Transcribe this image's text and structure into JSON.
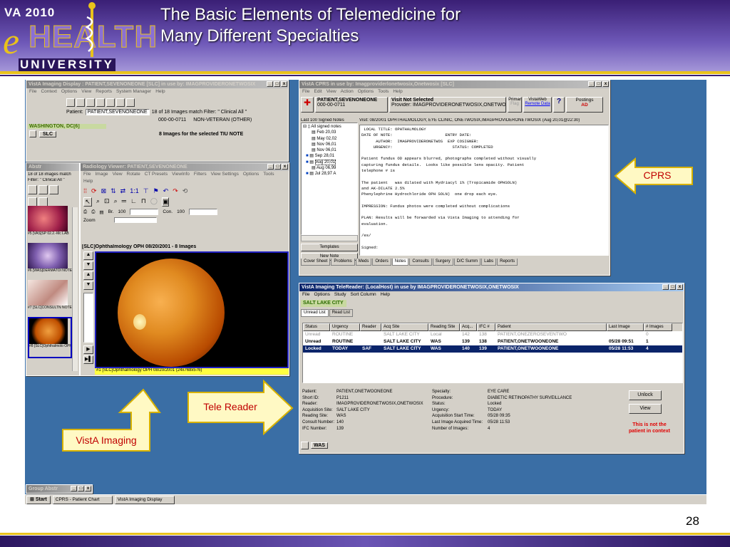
{
  "slide": {
    "logo_va": "VA 2010",
    "logo_e": "e",
    "logo_health": "HEALTH",
    "logo_university": "UNIVERSITY",
    "title_line1": "The Basic Elements of Telemedicine for",
    "title_line2": "Many Different Specialties",
    "page_number": "28",
    "colors": {
      "band": "#3a1f75",
      "gold": "#e9c21b",
      "desktop": "#3a6ea5"
    }
  },
  "callouts": {
    "cprs": "CPRS",
    "tele_reader": "Tele Reader",
    "vista_imaging": "VistA Imaging"
  },
  "imaging_display": {
    "title": "VistA Imaging Display : PATIENT,SEVENONEONE [SLC] in use by: IMAGPROVIDERONETWOSIX",
    "menu": [
      "File",
      "Context",
      "Options",
      "View",
      "Reports",
      "System Manager",
      "Help"
    ],
    "patient_label": "Patient:",
    "patient_value": "PATIENT,SEVENONEONE",
    "match_text": "18 of 18 Images match Filter: \" Clinical All \"",
    "ssn": "000-00-0711",
    "status": "NON-VETERAN (OTHER)",
    "site": "WASHINGTON, DC[6]",
    "slc_tab": "SLC",
    "images_text": "8 Images for the selected TIU NOTE"
  },
  "abstracts": {
    "title": "Abstr",
    "count_text": "18 of 18 images match",
    "filter_text": "Filter: \" Clinical All \"",
    "items": [
      {
        "caption": "#5 [VAS]SP 02.2.-Mc LAB"
      },
      {
        "caption": "#6 [WAS]DERMATOI NOTE"
      },
      {
        "caption": "#7 [SLC]CONSULTN NOTE"
      },
      {
        "caption": "#8 [SLC]Ophthalmolo OPH"
      }
    ]
  },
  "radiology_viewer": {
    "title": "Radiology Viewer: PATIENT,SEVENONEONE",
    "menu": [
      "File",
      "Image",
      "View",
      "Rotate",
      "CT Presets",
      "ViewInfo",
      "Filters",
      "View Settings",
      "Options",
      "Tools"
    ],
    "help": "Help",
    "brightness_label": "Br.",
    "brightness_value": "100",
    "contrast_label": "Con.",
    "contrast_value": "100",
    "zoom_label": "Zoom",
    "image_header": "[SLC]Ophthalmology OPH 08/20/2001   - 8  Images",
    "image_footer": "#1 [SLC]Ophthalmology OPH 08/20/2001 (24x768x576)"
  },
  "cprs": {
    "title": "VistA CPRS in use by: Imagproviderlonetwosix,Onetwosix  [SLC]",
    "menu": [
      "File",
      "Edit",
      "View",
      "Action",
      "Options",
      "Tools",
      "Help"
    ],
    "patient_name": "PATIENT,SEVENONEONE",
    "patient_id": "000-00-0711",
    "visit_label": "Visit Not Selected",
    "provider_label": "Provider:  IMAGPROVIDERONETWOSIX,ONETWOSIX",
    "primary_label": "Primar",
    "vistaweb_label": "VistaWeb",
    "remote_data_label": "Remote Data",
    "flag_label": "Flag",
    "postings_label": "Postings",
    "postings_value": "AD",
    "notes_list_header": "Last 100 Signed Notes",
    "all_signed": "All signed notes",
    "notes": [
      "Feb 20,03",
      "May 02,02",
      "Nov 06,01",
      "Nov 06,01",
      "Sep 28,01",
      "Aug 20,01",
      "Aug 06,99",
      "Jul 28,97 A"
    ],
    "templates_label": "Templates",
    "new_note_label": "New Note",
    "visit_header": "Visit: 08/20/01   OPHTHALMOLOGY, EYE CLINIC, ONETWOSIX,IMAGPROVIDERONETWOSIX  (Aug 20,01@22:30)",
    "note_text": [
      " LOCAL TITLE: OPHTHALMOLOGY",
      "DATE OF NOTE:                      ENTRY DATE:",
      "      AUTHOR:  IMAGPROVIDERONETWOS  EXP COSIGNER:",
      "     URGENCY:                         STATUS: COMPLETED",
      "",
      "Patient fundus OD appears blurred, photographs completed without visually",
      "capturing fundus details.  Looks like possible lens opacity. Patient",
      "telephone # is",
      "",
      "The patient   was dilated with Mydriacyl 1% (Tropicamide OPHSOLN)",
      "and AK-DILATE 2.5%",
      "Phenylephrine Hydrochloride OPH SOLN)  one drop each eye.",
      "",
      "IMPRESSION: Fundus photos were completed without complications",
      "",
      "PLAN: Results will be forwarded via Vista Imaging to attending for",
      "evaluation.",
      "",
      "/es/",
      "",
      "Signed:"
    ],
    "tabs": [
      "Cover Sheet",
      "Problems",
      "Meds",
      "Orders",
      "Notes",
      "Consults",
      "Surgery",
      "D/C Summ",
      "Labs",
      "Reports"
    ],
    "active_tab": "Notes"
  },
  "telereader": {
    "title": "VistA Imaging TeleReader: (LocalHost) in use by IMAGPROVIDERONETWOSIX,ONETWOSIX",
    "menu": [
      "File",
      "Options",
      "Study",
      "Sort Column",
      "Help"
    ],
    "site": "SALT LAKE CITY",
    "tabs": [
      "Unread List",
      "Read List"
    ],
    "columns": [
      "Status",
      "Urgency",
      "Reader",
      "Acq Site",
      "Reading Site",
      "Acq...",
      "IFC #",
      "Patient",
      "Last Image",
      "# Images"
    ],
    "rows": [
      {
        "status": "Unread",
        "urgency": "ROUTINE",
        "reader": "",
        "acq_site": "SALT LAKE CITY",
        "reading_site": "Local",
        "acq": "142",
        "ifc": "138",
        "patient": "PATIENT,ONEZEROSEVENTWO",
        "last_image": "",
        "images": "0",
        "style": "dim"
      },
      {
        "status": "Unread",
        "urgency": "ROUTINE",
        "reader": "",
        "acq_site": "SALT LAKE CITY",
        "reading_site": "WAS",
        "acq": "139",
        "ifc": "138",
        "patient": "PATIENT,ONETWOONEONE",
        "last_image": "05/28 09:51",
        "images": "1",
        "style": "bold"
      },
      {
        "status": "Locked",
        "urgency": "TODAY",
        "reader": "SAF",
        "acq_site": "SALT LAKE CITY",
        "reading_site": "WAS",
        "acq": "140",
        "ifc": "139",
        "patient": "PATIENT,ONETWOONEONE",
        "last_image": "05/28 11:53",
        "images": "4",
        "style": "selected"
      }
    ],
    "details_left": [
      {
        "label": "Patient:",
        "value": "PATIENT,ONETWOONEONE"
      },
      {
        "label": "Short ID:",
        "value": "P1211"
      },
      {
        "label": "Reader:",
        "value": "IMAGPROVIDERONETWOSIX,ONETWOSIX"
      },
      {
        "label": "Acquisition Site:",
        "value": "SALT LAKE CITY"
      },
      {
        "label": "Reading Site:",
        "value": "WAS"
      },
      {
        "label": "Consult Number:",
        "value": "140"
      },
      {
        "label": "IFC Number:",
        "value": "139"
      }
    ],
    "details_right": [
      {
        "label": "Specialty:",
        "value": "EYE CARE"
      },
      {
        "label": "Procedure:",
        "value": "DIABETIC RETINOPATHY SURVEILLANCE"
      },
      {
        "label": "Status:",
        "value": "Locked"
      },
      {
        "label": "Urgency:",
        "value": "TODAY"
      },
      {
        "label": "Acquisition Start Time:",
        "value": "05/28 09:35"
      },
      {
        "label": "Last Image Acquired Time:",
        "value": "05/28 11:53"
      },
      {
        "label": "Number of Images:",
        "value": "4"
      }
    ],
    "unlock_label": "Unlock",
    "view_label": "View",
    "warning_line1": "This is not the",
    "warning_line2": "patient in context",
    "status_site": "WAS"
  },
  "group_abstr": {
    "title": "Group Abstr"
  },
  "taskbar": {
    "start_label": "Start",
    "items": [
      "CPRS - Patient Chart",
      "VistA Imaging Display"
    ]
  }
}
